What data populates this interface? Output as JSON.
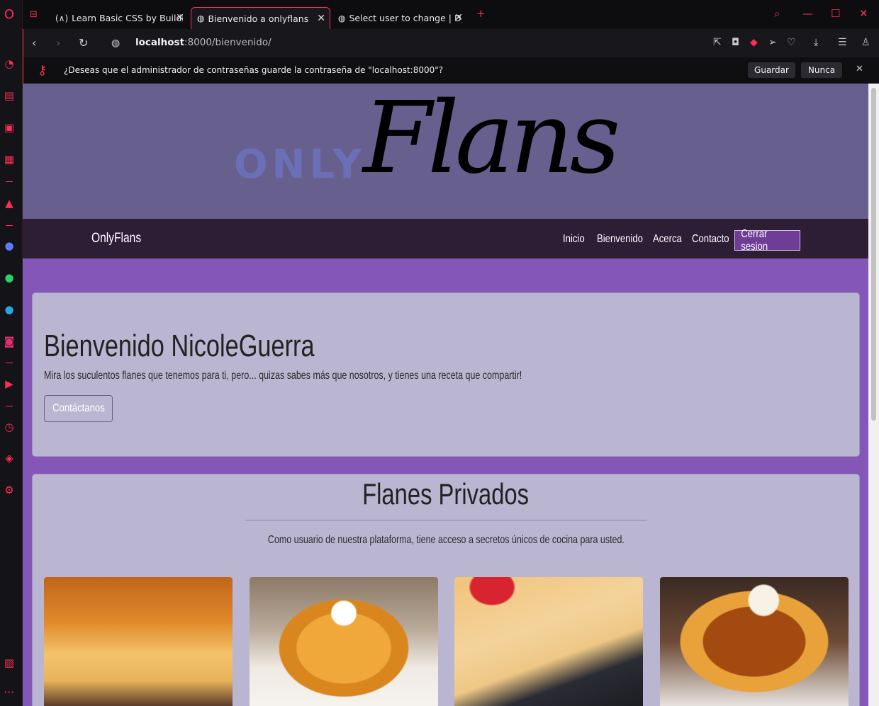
{
  "browser": {
    "tabs": [
      {
        "title": "Learn Basic CSS by Building",
        "icon": "freecodecamp-icon",
        "active": false
      },
      {
        "title": "Bienvenido a onlyflans",
        "icon": "globe-icon",
        "active": true
      },
      {
        "title": "Select user to change | Djan",
        "icon": "globe-icon",
        "active": false
      }
    ],
    "new_tab": "+",
    "url_host": "localhost",
    "url_path": ":8000/bienvenido/",
    "password_prompt": {
      "message": "¿Deseas que el administrador de contraseñas guarde la contraseña de \"localhost:8000\"?",
      "save_label": "Guardar",
      "never_label": "Nunca"
    },
    "accent_color": "#ff2d55"
  },
  "site": {
    "logo_only": "ONLY",
    "logo_flans": "Flans",
    "brand": "OnlyFlans",
    "nav": [
      "Inicio",
      "Bienvenido",
      "Acerca",
      "Contacto"
    ],
    "logout_label": "Cerrar sesion",
    "welcome": {
      "title": "Bienvenido NicoleGuerra",
      "text": "Mira los suculentos flanes que tenemos para ti, pero... quizas sabes más que nosotros, y tienes una receta que compartir!",
      "button": "Contáctanos"
    },
    "private": {
      "title": "Flanes Privados",
      "text": "Como usuario de nuestra plataforma, tiene acceso a secretos únicos de cocina para usted."
    },
    "images": [
      "flan-sliced-image",
      "flan-whipped-cream-image",
      "flan-strawberry-slice-image",
      "flan-coconut-image"
    ],
    "colors": {
      "banner": "#67608f",
      "navbar": "#2d1d35",
      "page": "#8356b8",
      "card": "#bab6d2",
      "logout": "#6f3c96"
    }
  }
}
